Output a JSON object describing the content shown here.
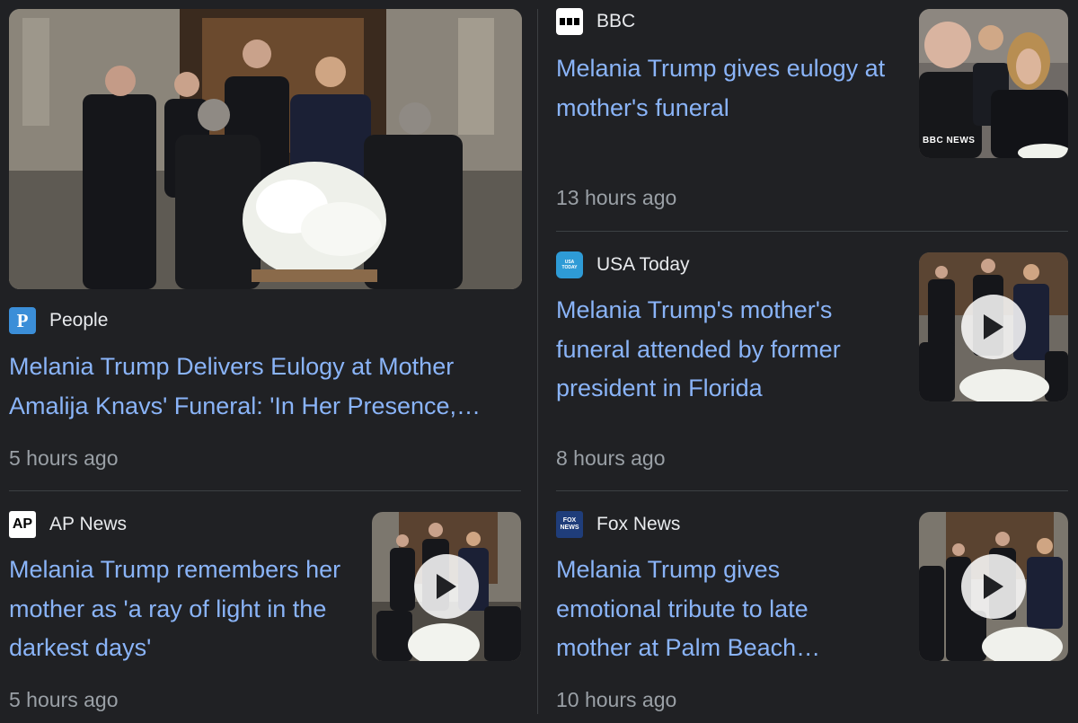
{
  "articles": [
    {
      "source": "People",
      "title": "Melania Trump Delivers Eulogy at Mother Amalija Knavs' Funeral: 'In Her Presence,…",
      "time": "5 hours ago"
    },
    {
      "source": "BBC",
      "title": "Melania Trump gives eulogy at mother's funeral",
      "time": "13 hours ago",
      "thumb_badge": "BBC NEWS"
    },
    {
      "source": "USA Today",
      "title": "Melania Trump's mother's funeral attended by former president in Florida",
      "time": "8 hours ago",
      "logo_text": "USA TODAY"
    },
    {
      "source": "AP News",
      "title": "Melania Trump remembers her mother as 'a ray of light in the darkest days'",
      "time": "5 hours ago",
      "logo_text": "AP"
    },
    {
      "source": "Fox News",
      "title": "Melania Trump gives emotional tribute to late mother at Palm Beach…",
      "time": "10 hours ago",
      "logo_text": "FOX NEWS"
    }
  ],
  "logos": {
    "people": "P"
  },
  "colors": {
    "background": "#202124",
    "link": "#8ab4f8",
    "divider": "#3c4043",
    "muted": "#9aa0a6"
  }
}
